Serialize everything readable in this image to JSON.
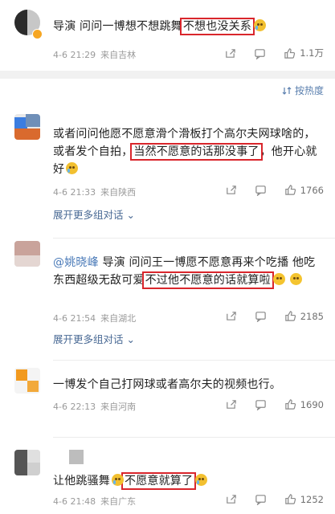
{
  "sort": {
    "label": "按热度"
  },
  "comments": [
    {
      "text_before": "导演 问问一博想不想跳舞",
      "highlight": "不想也没关系",
      "time": "4-6 21:29",
      "place": "来自吉林",
      "likes": "1.1万"
    },
    {
      "text_before": "或者问问他愿不愿意滑个滑板打个高尔夫网球啥的，或者发个自拍，",
      "highlight": "当然不愿意的话那没事了",
      "text_after": "，他开心就好",
      "time": "4-6 21:33",
      "place": "来自陕西",
      "likes": "1766",
      "expand": "展开更多组对话"
    },
    {
      "mention": "@姚晓峰",
      "text_before": " 导演 问问王一博愿不愿意再来个吃播 他吃东西超级无敌可爱",
      "highlight": "不过他不愿意的话就算啦",
      "time": "4-6 21:54",
      "place": "来自湖北",
      "likes": "2185",
      "expand": "展开更多组对话"
    },
    {
      "text_before": "一博发个自己打网球或者高尔夫的视频也行。",
      "time": "4-6 22:13",
      "place": "来自河南",
      "likes": "1690"
    },
    {
      "text_before": "让他跳骚舞",
      "highlight": "不愿意就算了",
      "time": "4-6 21:48",
      "place": "来自广东",
      "likes": "1252"
    }
  ],
  "colors": {
    "highlight_box": "#d9262c",
    "link": "#4a6a95",
    "meta": "#9a9a9a"
  }
}
